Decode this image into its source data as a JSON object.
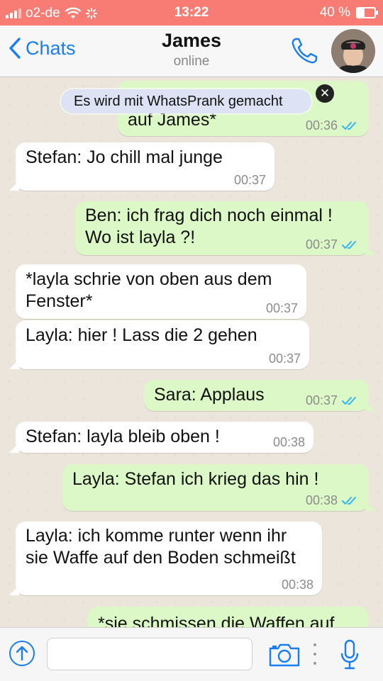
{
  "status_bar": {
    "carrier": "o2-de",
    "time": "13:22",
    "battery": "40 %",
    "battery_level": 0.4
  },
  "header": {
    "back_label": "Chats",
    "contact_name": "James",
    "contact_status": "online",
    "call_icon": "phone-icon",
    "avatar_icon": "avatar-icon"
  },
  "banner": {
    "text": "Es wird mit WhatsPrank gemacht",
    "close_icon": "close-icon"
  },
  "colors": {
    "status_bar": "#f97c74",
    "accent": "#1a7cf2",
    "outgoing_bubble": "#dcf8c6",
    "incoming_bubble": "#ffffff",
    "read_ticks": "#34b7f1"
  },
  "messages": [
    {
      "dir": "out",
      "text": "auf James*",
      "time": "00:36",
      "read": true
    },
    {
      "dir": "in",
      "text": "Stefan: Jo chill mal junge",
      "time": "00:37"
    },
    {
      "dir": "out",
      "text": "Ben: ich frag dich noch einmal ! Wo ist layla ?!",
      "time": "00:37",
      "read": true
    },
    {
      "dir": "in",
      "text": "*layla schrie von oben aus dem Fenster*",
      "time": "00:37"
    },
    {
      "dir": "in",
      "text": "Layla: hier ! Lass die 2 gehen",
      "time": "00:37"
    },
    {
      "dir": "out",
      "text": "Sara: Applaus",
      "time": "00:37",
      "read": true
    },
    {
      "dir": "in",
      "text": "Stefan: layla bleib oben !",
      "time": "00:38"
    },
    {
      "dir": "out",
      "text": "Layla: Stefan ich krieg das hin !",
      "time": "00:38",
      "read": true
    },
    {
      "dir": "in",
      "text": "Layla: ich komme runter wenn ihr sie Waffe auf den Boden schmeißt",
      "time": "00:38"
    },
    {
      "dir": "out",
      "text": "*sie schmissen die Waffen auf",
      "time": ""
    }
  ],
  "input_bar": {
    "message_value": "",
    "message_placeholder": "",
    "icons": [
      "send-up-icon",
      "camera-icon",
      "more-icon",
      "microphone-icon"
    ]
  }
}
